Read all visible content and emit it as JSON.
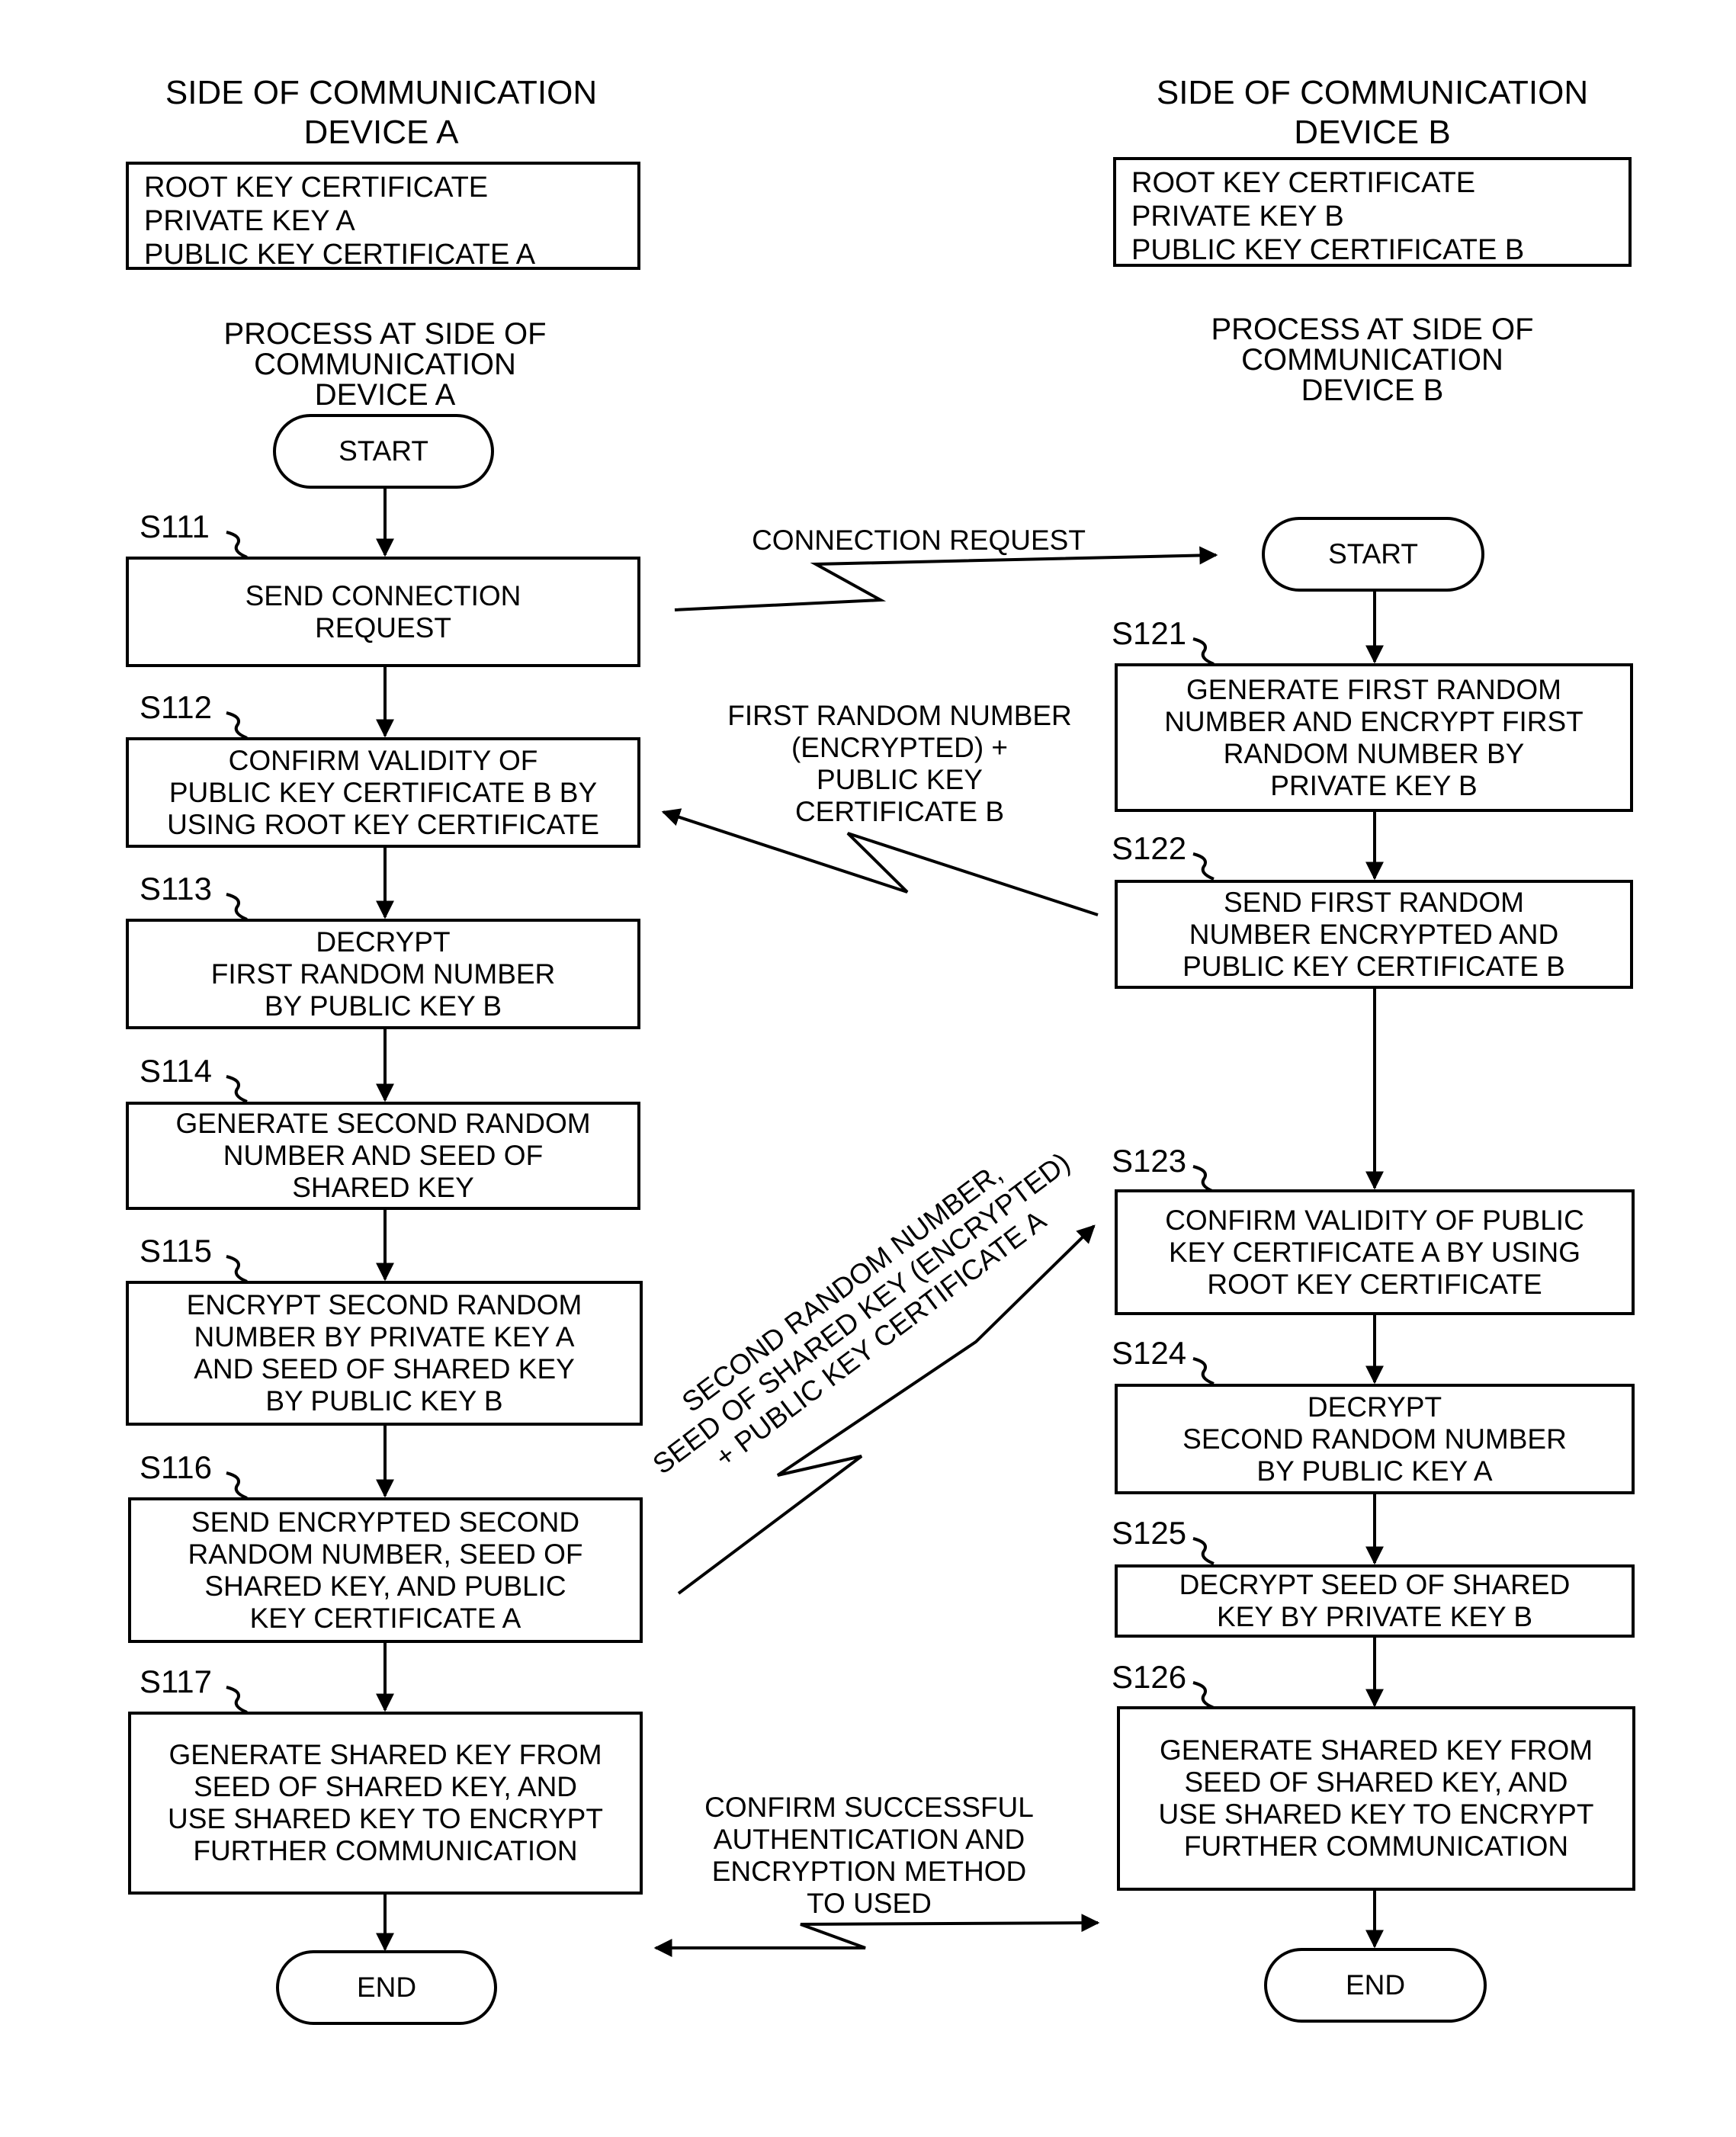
{
  "device_a": {
    "header": "SIDE OF COMMUNICATION\nDEVICE A",
    "keys": [
      "ROOT KEY CERTIFICATE",
      "PRIVATE KEY A",
      "PUBLIC KEY CERTIFICATE A"
    ],
    "process_title": "PROCESS AT SIDE OF\nCOMMUNICATION\nDEVICE A",
    "start_label": "START",
    "end_label": "END",
    "steps": [
      {
        "id": "S111",
        "text": "SEND CONNECTION\nREQUEST"
      },
      {
        "id": "S112",
        "text": "CONFIRM VALIDITY OF\nPUBLIC KEY CERTIFICATE B BY\nUSING ROOT KEY CERTIFICATE"
      },
      {
        "id": "S113",
        "text": "DECRYPT\nFIRST RANDOM NUMBER\nBY PUBLIC KEY B"
      },
      {
        "id": "S114",
        "text": "GENERATE SECOND RANDOM\nNUMBER AND SEED OF\nSHARED KEY"
      },
      {
        "id": "S115",
        "text": "ENCRYPT SECOND RANDOM\nNUMBER BY PRIVATE KEY A\nAND SEED OF SHARED KEY\nBY PUBLIC KEY B"
      },
      {
        "id": "S116",
        "text": "SEND ENCRYPTED SECOND\nRANDOM NUMBER, SEED OF\nSHARED KEY, AND PUBLIC\nKEY CERTIFICATE A"
      },
      {
        "id": "S117",
        "text": "GENERATE SHARED KEY FROM\nSEED OF SHARED KEY, AND\nUSE SHARED KEY TO ENCRYPT\nFURTHER COMMUNICATION"
      }
    ]
  },
  "device_b": {
    "header": "SIDE OF COMMUNICATION\nDEVICE B",
    "keys": [
      "ROOT KEY CERTIFICATE",
      "PRIVATE KEY B",
      "PUBLIC KEY CERTIFICATE B"
    ],
    "process_title": "PROCESS AT SIDE OF\nCOMMUNICATION\nDEVICE B",
    "start_label": "START",
    "end_label": "END",
    "steps": [
      {
        "id": "S121",
        "text": "GENERATE FIRST RANDOM\nNUMBER AND ENCRYPT FIRST\nRANDOM NUMBER BY\nPRIVATE KEY B"
      },
      {
        "id": "S122",
        "text": "SEND FIRST RANDOM\nNUMBER ENCRYPTED AND\nPUBLIC KEY CERTIFICATE B"
      },
      {
        "id": "S123",
        "text": "CONFIRM VALIDITY OF PUBLIC\nKEY CERTIFICATE A BY USING\nROOT KEY CERTIFICATE"
      },
      {
        "id": "S124",
        "text": "DECRYPT\nSECOND RANDOM NUMBER\nBY PUBLIC KEY A"
      },
      {
        "id": "S125",
        "text": "DECRYPT SEED OF SHARED\nKEY BY PRIVATE KEY B"
      },
      {
        "id": "S126",
        "text": "GENERATE SHARED KEY FROM\nSEED OF SHARED KEY, AND\nUSE SHARED KEY TO ENCRYPT\nFURTHER COMMUNICATION"
      }
    ]
  },
  "messages": {
    "connection_request": "CONNECTION REQUEST",
    "first_random": "FIRST RANDOM NUMBER\n(ENCRYPTED) +\nPUBLIC KEY\nCERTIFICATE B",
    "second_random": "SECOND RANDOM NUMBER,\nSEED OF SHARED KEY (ENCRYPTED)\n+ PUBLIC KEY CERTIFICATE A",
    "confirm": "CONFIRM SUCCESSFUL\nAUTHENTICATION AND\nENCRYPTION METHOD\nTO USED"
  }
}
